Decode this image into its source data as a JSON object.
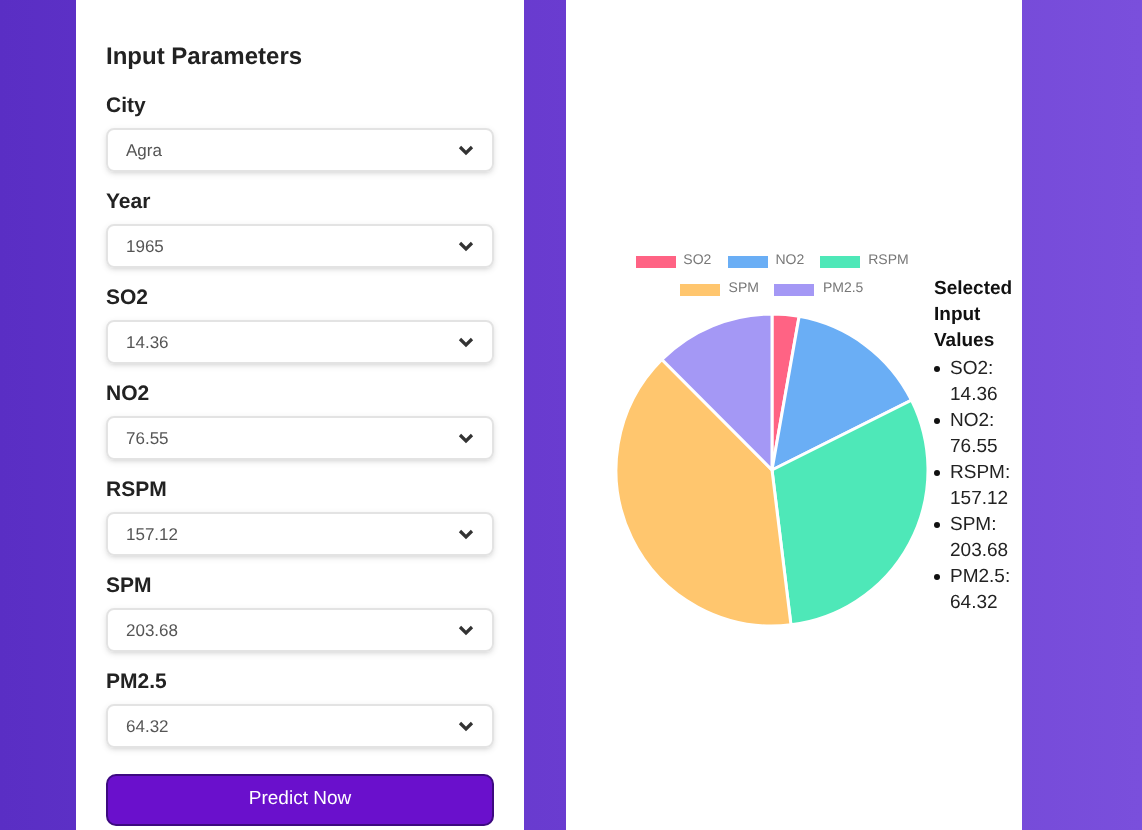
{
  "form": {
    "title": "Input Parameters",
    "fields": [
      {
        "label": "City",
        "value": "Agra"
      },
      {
        "label": "Year",
        "value": "1965"
      },
      {
        "label": "SO2",
        "value": "14.36"
      },
      {
        "label": "NO2",
        "value": "76.55"
      },
      {
        "label": "RSPM",
        "value": "157.12"
      },
      {
        "label": "SPM",
        "value": "203.68"
      },
      {
        "label": "PM2.5",
        "value": "64.32"
      }
    ],
    "button": "Predict Now"
  },
  "chart": {
    "chart_data": {
      "type": "pie",
      "categories": [
        "SO2",
        "NO2",
        "RSPM",
        "SPM",
        "PM2.5"
      ],
      "values": [
        2.78,
        14.83,
        30.45,
        39.47,
        12.47
      ],
      "legend": "top",
      "colors": [
        "#ff6384",
        "#6aaef5",
        "#4ee8b8",
        "#ffc66e",
        "#a498f5"
      ]
    }
  },
  "selected": {
    "title": "Selected Input Values",
    "items": [
      "SO2: 14.36",
      "NO2: 76.55",
      "RSPM: 157.12",
      "SPM: 203.68",
      "PM2.5: 64.32"
    ]
  }
}
